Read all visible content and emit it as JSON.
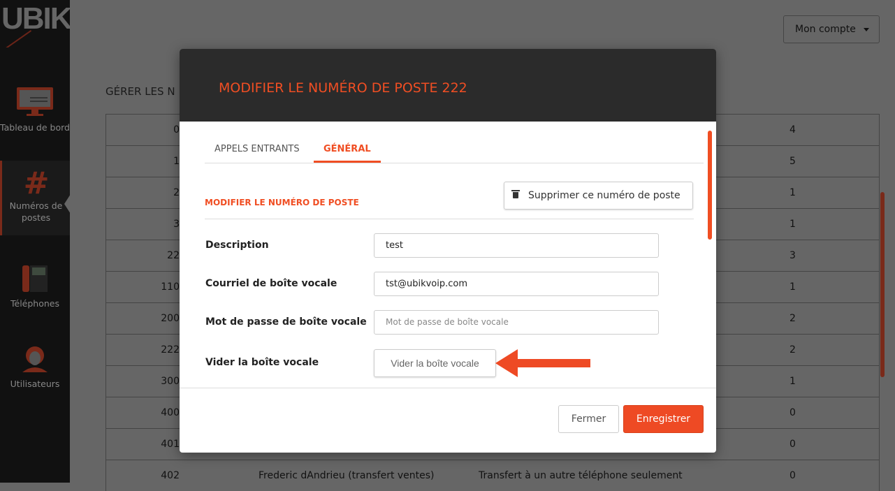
{
  "brand": {
    "logo": "UBIK",
    "accent": "#f04e23"
  },
  "sidebar": {
    "items": [
      {
        "label": "Tableau de bord",
        "icon": "monitor-phone-icon"
      },
      {
        "label": "Numéros de postes",
        "icon": "hash-icon",
        "active": true
      },
      {
        "label": "Téléphones",
        "icon": "desk-phone-icon"
      },
      {
        "label": "Utilisateurs",
        "icon": "user-icon"
      }
    ]
  },
  "header": {
    "account": "Mon compte"
  },
  "page": {
    "title": "GÉRER LES N"
  },
  "table": {
    "rows": [
      [
        "0",
        "",
        "",
        "4"
      ],
      [
        "1",
        "",
        "",
        "5"
      ],
      [
        "2",
        "",
        "",
        "1"
      ],
      [
        "3",
        "",
        "",
        "1"
      ],
      [
        "22",
        "",
        "",
        "3"
      ],
      [
        "110",
        "",
        "",
        "1"
      ],
      [
        "200",
        "",
        "",
        "2"
      ],
      [
        "222",
        "",
        "",
        "2"
      ],
      [
        "300",
        "",
        "",
        "1"
      ],
      [
        "400",
        "",
        "",
        "0"
      ],
      [
        "401",
        "",
        "",
        "0"
      ],
      [
        "402",
        "Frederic dAndrieu (transfert ventes)",
        "Transfert à un autre téléphone seulement",
        "0"
      ]
    ]
  },
  "modal": {
    "title": "MODIFIER LE NUMÉRO DE POSTE 222",
    "tabs": [
      "APPELS ENTRANTS",
      "GÉNÉRAL"
    ],
    "section": "MODIFIER LE NUMÉRO DE POSTE",
    "delete": "Supprimer ce numéro de poste",
    "fields": {
      "description": {
        "label": "Description",
        "value": "test"
      },
      "email": {
        "label": "Courriel de boîte vocale",
        "value": "tst@ubikvoip.com"
      },
      "password": {
        "label": "Mot de passe de boîte vocale",
        "placeholder": "Mot de passe de boîte vocale"
      },
      "clear": {
        "label": "Vider la boîte vocale",
        "button": "Vider la boîte vocale"
      }
    },
    "close": "Fermer",
    "save": "Enregistrer"
  }
}
